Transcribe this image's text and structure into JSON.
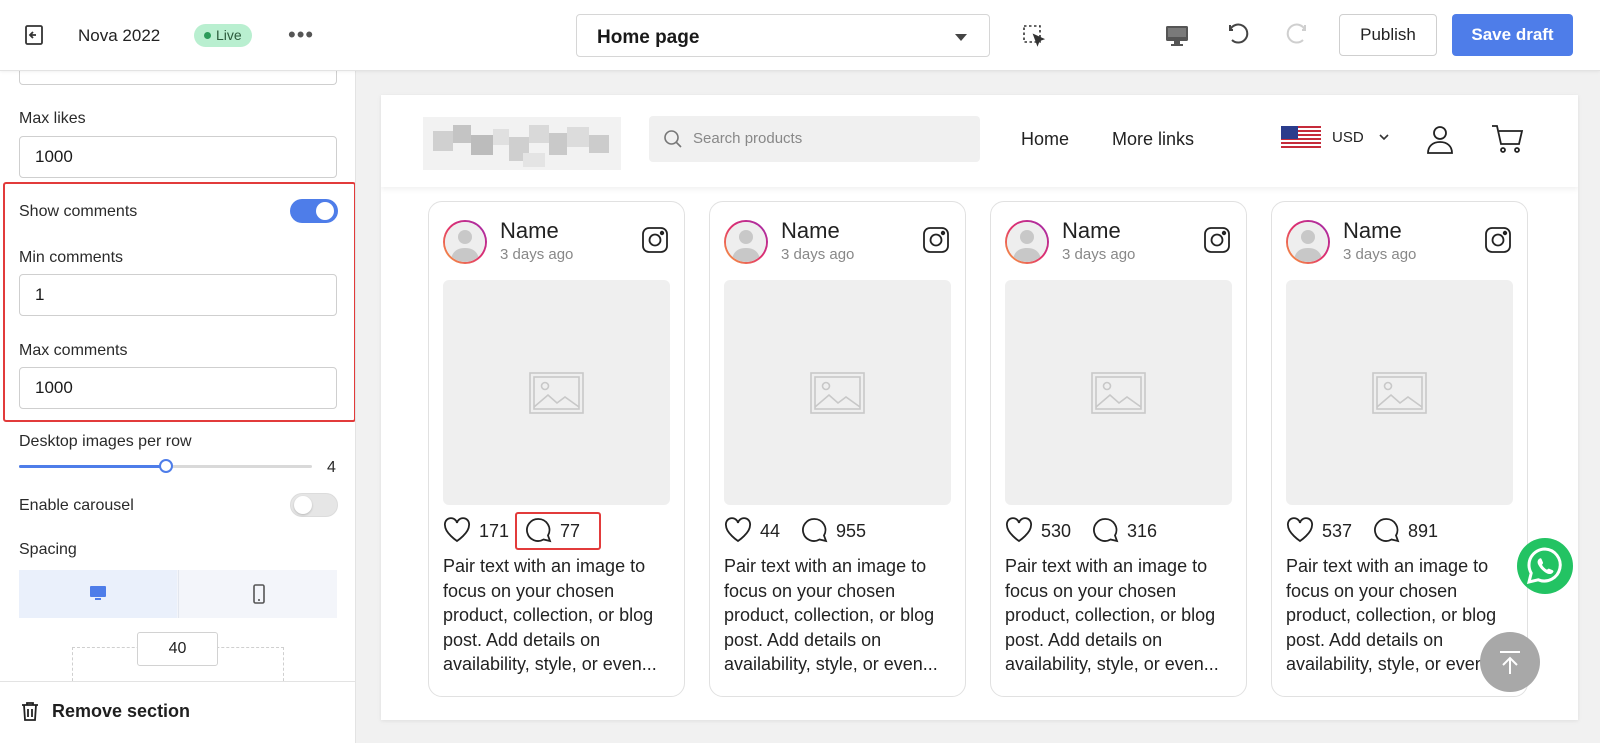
{
  "topbar": {
    "store_name": "Nova 2022",
    "status": "Live",
    "more": "•••",
    "page_select": "Home page",
    "publish": "Publish",
    "save_draft": "Save draft"
  },
  "sidebar": {
    "max_likes_label": "Max likes",
    "max_likes_value": "1000",
    "show_comments_label": "Show comments",
    "show_comments_on": true,
    "min_comments_label": "Min comments",
    "min_comments_value": "1",
    "max_comments_label": "Max comments",
    "max_comments_value": "1000",
    "images_per_row_label": "Desktop images per row",
    "images_per_row_value": "4",
    "images_per_row_fraction": 0.5,
    "carousel_label": "Enable carousel",
    "carousel_on": false,
    "spacing_label": "Spacing",
    "spacing_value": "40",
    "remove_section": "Remove section"
  },
  "store": {
    "search_placeholder": "Search products",
    "nav": [
      "Home",
      "More links"
    ],
    "currency": "USD"
  },
  "cards": [
    {
      "name": "Name",
      "time": "3 days ago",
      "likes": "171",
      "comments": "77",
      "text": "Pair text with an image to focus on your chosen product, collection, or blog post. Add details on availability, style, or even..."
    },
    {
      "name": "Name",
      "time": "3 days ago",
      "likes": "44",
      "comments": "955",
      "text": "Pair text with an image to focus on your chosen product, collection, or blog post. Add details on availability, style, or even..."
    },
    {
      "name": "Name",
      "time": "3 days ago",
      "likes": "530",
      "comments": "316",
      "text": "Pair text with an image to focus on your chosen product, collection, or blog post. Add details on availability, style, or even..."
    },
    {
      "name": "Name",
      "time": "3 days ago",
      "likes": "537",
      "comments": "891",
      "text": "Pair text with an image to focus on your chosen product, collection, or blog post. Add details on availability, style, or even..."
    }
  ],
  "colors": {
    "accent": "#4e7de9",
    "highlight": "#e23b3b",
    "live_badge": "#b9efd0",
    "whatsapp": "#23c363"
  }
}
